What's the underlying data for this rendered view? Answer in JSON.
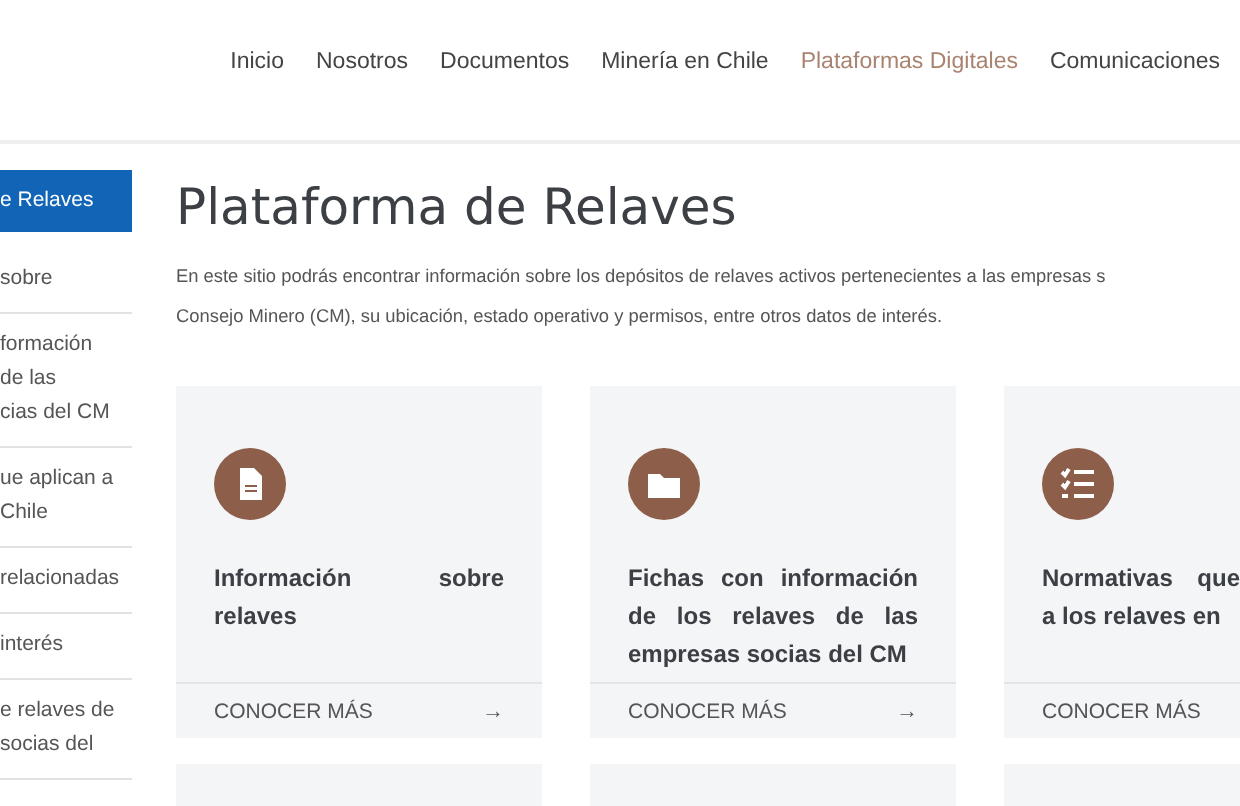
{
  "nav": [
    {
      "label": "Inicio",
      "selected": false
    },
    {
      "label": "Nosotros",
      "selected": false
    },
    {
      "label": "Documentos",
      "selected": false
    },
    {
      "label": "Minería en Chile",
      "selected": false
    },
    {
      "label": "Plataformas Digitales",
      "selected": true
    },
    {
      "label": "Comunicaciones",
      "selected": false
    }
  ],
  "sidebar": {
    "items": [
      {
        "lines": [
          "e Relaves"
        ],
        "selected": true
      },
      {
        "lines": [
          "sobre"
        ],
        "selected": false
      },
      {
        "lines": [
          "formación",
          "de las",
          "cias del CM"
        ],
        "selected": false
      },
      {
        "lines": [
          "ue aplican a",
          "Chile"
        ],
        "selected": false
      },
      {
        "lines": [
          "relacionadas"
        ],
        "selected": false
      },
      {
        "lines": [
          "interés"
        ],
        "selected": false
      },
      {
        "lines": [
          "e relaves de",
          "socias del"
        ],
        "selected": false
      }
    ]
  },
  "page": {
    "title": "Plataforma de Relaves",
    "intro": [
      "En este sitio podrás encontrar información sobre los depósitos de relaves activos pertenecientes a las empresas s",
      "Consejo Minero (CM), su ubicación, estado operativo y permisos, entre otros datos de interés."
    ]
  },
  "cards": [
    {
      "kind": "document",
      "title_lines": [
        "Información sobre",
        "relaves"
      ],
      "link": "CONOCER MÁS",
      "arrow": "→"
    },
    {
      "kind": "folder",
      "title_lines": [
        "Fichas con información",
        "de los relaves de las",
        "empresas socias del CM"
      ],
      "link": "CONOCER MÁS",
      "arrow": "→"
    },
    {
      "kind": "list",
      "title_lines": [
        "Normativas que",
        "a los relaves en"
      ],
      "link": "CONOCER MÁS"
    }
  ]
}
